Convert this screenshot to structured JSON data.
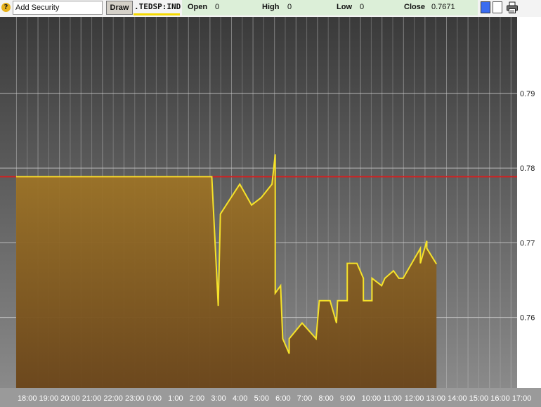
{
  "toolbar": {
    "help_icon": "question-icon",
    "search_value": "Add Security",
    "draw_label": "Draw",
    "ticker": ".TEDSP:IND",
    "open_label": "Open",
    "open_value": "0",
    "high_label": "High",
    "high_value": "0",
    "low_label": "Low",
    "low_value": "0",
    "close_label": "Close",
    "close_value": "0.7671",
    "print_icon": "printer-icon",
    "colors": {
      "swatch_blue": "#3a6cf0",
      "swatch_white": "#ffffff",
      "quote_bar": "#dcefd8",
      "ticker_underline": "#f4d800"
    }
  },
  "chart_data": {
    "type": "area",
    "colors": {
      "line": "#f5e22a",
      "fill": "#9b6e25",
      "reference": "#d42020",
      "background_top": "#3a3a3a",
      "background_bottom": "#8a8a8a"
    },
    "grid": true,
    "ylim": [
      0.7505,
      0.8002
    ],
    "yticks": [
      0.76,
      0.77,
      0.78,
      0.79
    ],
    "ytick_labels": [
      "0.76",
      "0.77",
      "0.78",
      "0.79"
    ],
    "reference_line": 0.7788,
    "xlim": [
      -0.75,
      23.3
    ],
    "xtick_labels": [
      "18:00",
      "19:00",
      "20:00",
      "21:00",
      "22:00",
      "23:00",
      "0:00",
      "1:00",
      "2:00",
      "3:00",
      "4:00",
      "5:00",
      "6:00",
      "7:00",
      "8:00",
      "9:00",
      "10:00",
      "11:00",
      "12:00",
      "13:00",
      "14:00",
      "15:00",
      "16:00",
      "17:00"
    ],
    "series": [
      {
        "x": [
          0.0,
          9.1,
          9.4,
          9.5,
          10.4,
          10.95,
          11.4,
          11.9,
          12.05,
          12.05,
          12.3,
          12.4,
          12.7,
          12.7,
          13.3,
          13.95,
          14.1,
          14.1,
          14.6,
          14.9,
          14.95,
          15.4,
          15.4,
          15.85,
          16.15,
          16.15,
          16.55,
          16.55,
          17.0,
          17.15,
          17.15,
          17.55,
          17.8,
          18.0,
          18.8,
          18.8,
          19.1,
          19.1,
          19.55
        ],
        "y": [
          0.7788,
          0.7788,
          0.7615,
          0.7738,
          0.7778,
          0.775,
          0.776,
          0.7778,
          0.7818,
          0.7632,
          0.7642,
          0.7571,
          0.7551,
          0.7571,
          0.7592,
          0.7571,
          0.7622,
          0.7622,
          0.7622,
          0.7592,
          0.7622,
          0.7622,
          0.7672,
          0.7672,
          0.7652,
          0.7622,
          0.7622,
          0.7652,
          0.7642,
          0.7652,
          0.7652,
          0.7662,
          0.7652,
          0.7652,
          0.7692,
          0.7672,
          0.7702,
          0.7692,
          0.7671
        ]
      }
    ]
  }
}
